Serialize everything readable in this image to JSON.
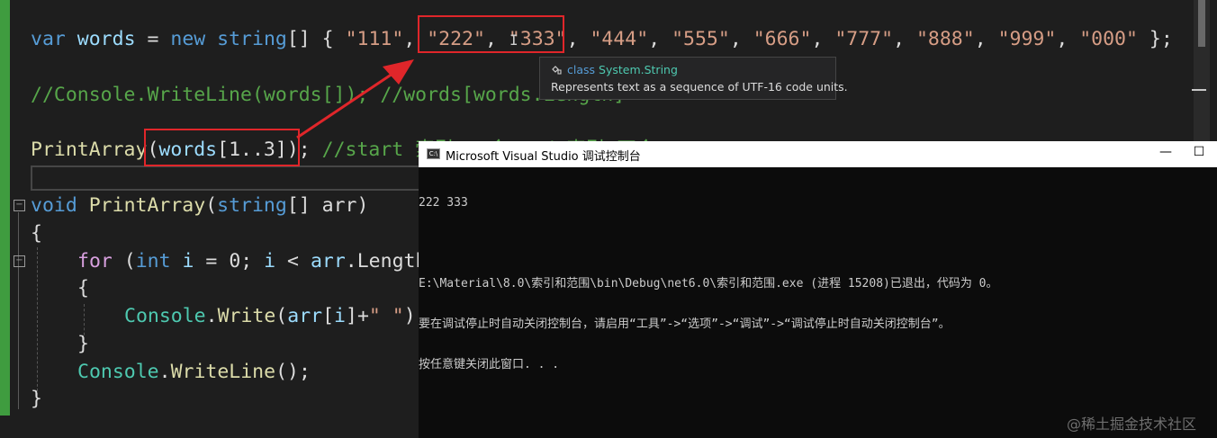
{
  "editor": {
    "line1": {
      "kw_var": "var",
      "ident": "words",
      "eq": " = ",
      "kw_new": "new",
      "kw_string": "string",
      "brackets": "[] { ",
      "s1": "\"111\"",
      "s2": "\"222\"",
      "s3": "\"333\"",
      "s4": "\"444\"",
      "s5": "\"555\"",
      "s6": "\"666\"",
      "s7": "\"777\"",
      "s8": "\"888\"",
      "s9": "\"999\"",
      "s10": "\"000\"",
      "sep": ", ",
      "end": " };"
    },
    "line2": {
      "comment": "//Console.WriteLine(words[]); //words[words.Length]"
    },
    "line3": {
      "method": "PrintArray",
      "open": "(",
      "arg": "words",
      "range": "[1..3]",
      "close": ");",
      "comment": " //start 索引 - 含 end 索引 不含"
    },
    "line4": {
      "kw_void": "void",
      "method": "PrintArray",
      "open": "(",
      "kw_string": "string",
      "rest": "[] arr)"
    },
    "line5": {
      "brace": "{"
    },
    "line6": {
      "kw_for": "for",
      "open": " (",
      "kw_int": "int",
      "v_i": "i",
      "mid": " = 0; ",
      "v_i2": "i",
      "lt": " < ",
      "v_arr": "arr",
      "length": ".Length"
    },
    "line7": {
      "brace": "{"
    },
    "line8": {
      "cls": "Console",
      "dot": ".",
      "method": "Write",
      "open": "(",
      "v_arr": "arr",
      "idx_open": "[",
      "v_i": "i",
      "idx_close": "]+",
      "str": "\" \"",
      "close": ");"
    },
    "line9": {
      "brace": "}"
    },
    "line10": {
      "cls": "Console",
      "dot": ".",
      "method": "WriteLine",
      "close": "();"
    },
    "line11": {
      "brace": "}"
    }
  },
  "tooltip": {
    "kind": "class",
    "name": "System.String",
    "description": "Represents text as a sequence of UTF-16 code units."
  },
  "console": {
    "icon_text": "C:\\",
    "title": "Microsoft Visual Studio 调试控制台",
    "minimize": "—",
    "maximize": "☐",
    "output": [
      "222 333",
      "",
      "E:\\Material\\8.0\\索引和范围\\bin\\Debug\\net6.0\\索引和范围.exe (进程 15208)已退出，代码为 0。",
      "要在调试停止时自动关闭控制台，请启用“工具”->“选项”->“调试”->“调试停止时自动关闭控制台”。",
      "按任意键关闭此窗口. . ."
    ]
  },
  "watermark": "@稀土掘金技术社区",
  "colors": {
    "accent_red": "#e0262a",
    "keyword": "#569cd6",
    "string": "#d69d85",
    "comment": "#57a64a",
    "method": "#dcdcaa",
    "class": "#4ec9b0"
  }
}
